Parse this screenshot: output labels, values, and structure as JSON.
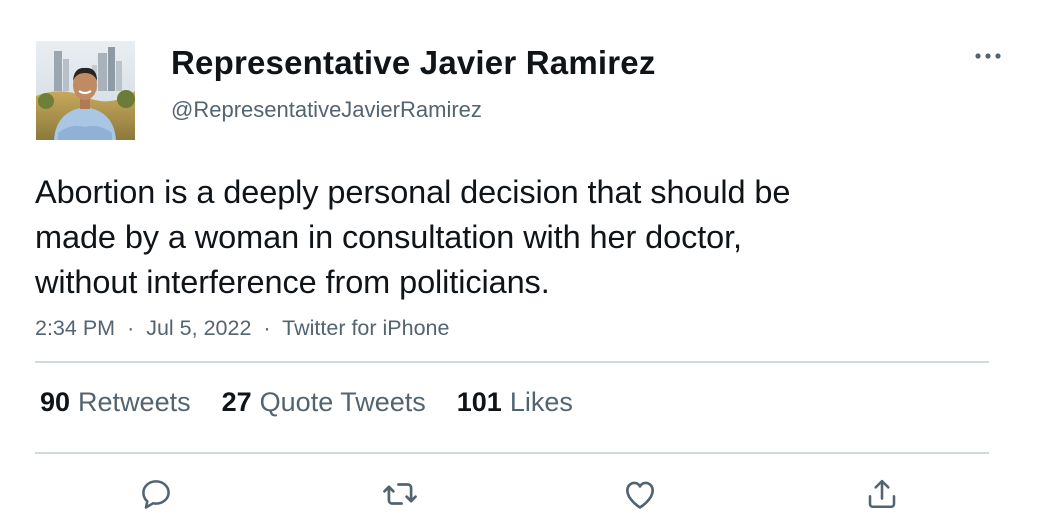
{
  "author": {
    "name": "Representative Javier Ramirez",
    "handle": "@RepresentativeJavierRamirez"
  },
  "tweet": {
    "text_lines": [
      "Abortion is a deeply personal decision that should be",
      "made by a woman in consultation with her doctor,",
      "without interference from politicians."
    ],
    "time": "2:34 PM",
    "date": "Jul 5, 2022",
    "source": "Twitter for iPhone",
    "separator": "·"
  },
  "stats": {
    "retweets_count": "90",
    "retweets_label": "Retweets",
    "quotes_count": "27",
    "quotes_label": "Quote Tweets",
    "likes_count": "101",
    "likes_label": "Likes"
  },
  "icons": {
    "more": "more-dots-icon",
    "reply": "reply-icon",
    "retweet": "retweet-icon",
    "like": "like-icon",
    "share": "share-icon"
  },
  "colors": {
    "text_primary": "#0f1419",
    "text_secondary": "#536471",
    "divider": "#cfd9de"
  }
}
